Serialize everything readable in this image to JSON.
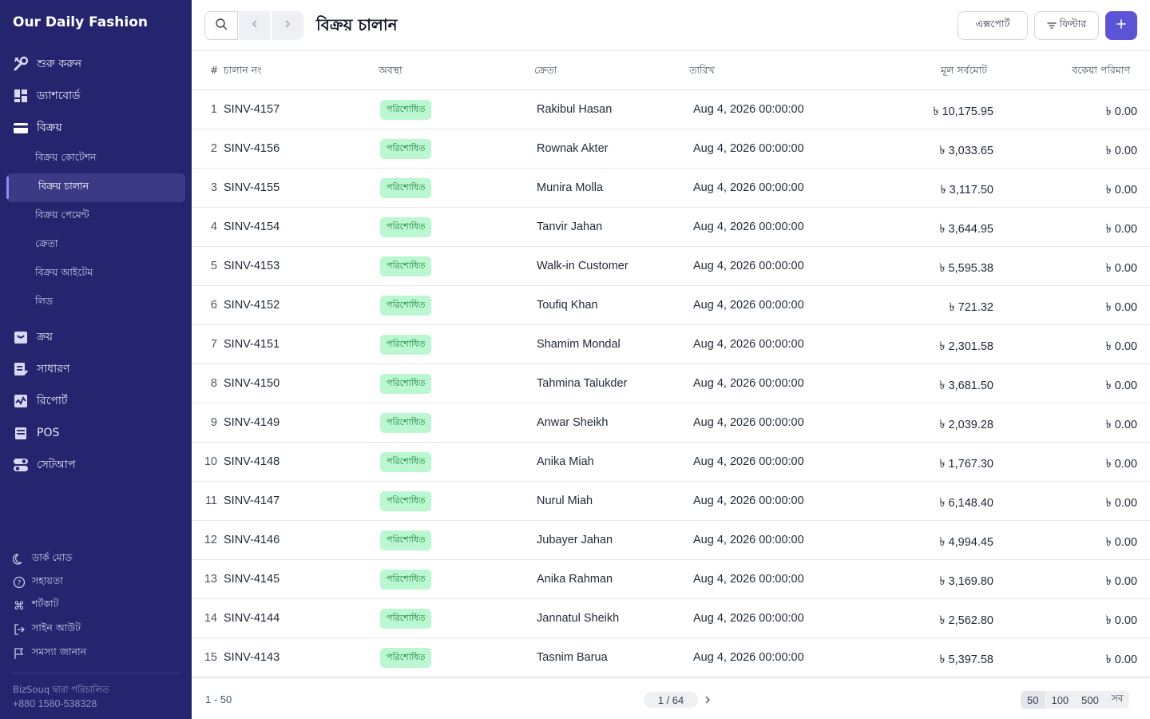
{
  "app": {
    "brand": "Our Daily Fashion",
    "powered_by": "BizSouq দ্বারা পরিচালিত",
    "phone": "+880 1580-538328"
  },
  "colors": {
    "sidebar_bg": "#25246e",
    "accent": "#5b55d6",
    "status_bg": "#bbf7d0",
    "status_text": "#15803d"
  },
  "sidebar": {
    "main": [
      {
        "label": "শুরু করুন",
        "icon": "tools-icon"
      },
      {
        "label": "ড্যাশবোর্ড",
        "icon": "dashboard-icon"
      },
      {
        "label": "বিক্রয়",
        "icon": "sales-card-icon"
      }
    ],
    "sub": [
      {
        "label": "বিক্রয় কোটেশন"
      },
      {
        "label": "বিক্রয় চালান",
        "active": true
      },
      {
        "label": "বিক্রয় পেমেন্ট"
      },
      {
        "label": "ক্রেতা"
      },
      {
        "label": "বিক্রয় আইটেম"
      },
      {
        "label": "লিড"
      }
    ],
    "more": [
      {
        "label": "ক্রয়",
        "icon": "purchase-icon"
      },
      {
        "label": "সাধারণ",
        "icon": "general-icon"
      },
      {
        "label": "রিপোর্ট",
        "icon": "report-icon"
      },
      {
        "label": "POS",
        "icon": "pos-icon"
      },
      {
        "label": "সেটআপ",
        "icon": "setup-icon"
      }
    ],
    "footer": [
      {
        "label": "ডার্ক মোড",
        "icon": "moon-icon"
      },
      {
        "label": "সহায়তা",
        "icon": "help-icon"
      },
      {
        "label": "শর্টকাট",
        "icon": "command-icon"
      },
      {
        "label": "সাইন আউট",
        "icon": "sign-out-icon"
      },
      {
        "label": "সমস্যা জানান",
        "icon": "flag-icon"
      }
    ]
  },
  "header": {
    "title": "বিক্রয় চালান",
    "export_label": "এক্সপোর্ট",
    "filter_label": "ফিল্টার"
  },
  "table": {
    "columns": {
      "num": "#",
      "invoice": "চালান নং",
      "status": "অবস্থা",
      "customer": "ক্রেতা",
      "date": "তারিখ",
      "grand_total": "মূল সর্বমোট",
      "outstanding": "বকেয়া পরিমাণ"
    },
    "rows": [
      {
        "num": "1",
        "invoice": "SINV-4157",
        "status": "পরিশোধিত",
        "customer": "Rakibul Hasan",
        "date": "Aug 4, 2026 00:00:00",
        "grand_total": "৳ 10,175.95",
        "outstanding": "৳ 0.00"
      },
      {
        "num": "2",
        "invoice": "SINV-4156",
        "status": "পরিশোধিত",
        "customer": "Rownak Akter",
        "date": "Aug 4, 2026 00:00:00",
        "grand_total": "৳ 3,033.65",
        "outstanding": "৳ 0.00"
      },
      {
        "num": "3",
        "invoice": "SINV-4155",
        "status": "পরিশোধিত",
        "customer": "Munira Molla",
        "date": "Aug 4, 2026 00:00:00",
        "grand_total": "৳ 3,117.50",
        "outstanding": "৳ 0.00"
      },
      {
        "num": "4",
        "invoice": "SINV-4154",
        "status": "পরিশোধিত",
        "customer": "Tanvir Jahan",
        "date": "Aug 4, 2026 00:00:00",
        "grand_total": "৳ 3,644.95",
        "outstanding": "৳ 0.00"
      },
      {
        "num": "5",
        "invoice": "SINV-4153",
        "status": "পরিশোধিত",
        "customer": "Walk-in Customer",
        "date": "Aug 4, 2026 00:00:00",
        "grand_total": "৳ 5,595.38",
        "outstanding": "৳ 0.00"
      },
      {
        "num": "6",
        "invoice": "SINV-4152",
        "status": "পরিশোধিত",
        "customer": "Toufiq Khan",
        "date": "Aug 4, 2026 00:00:00",
        "grand_total": "৳ 721.32",
        "outstanding": "৳ 0.00"
      },
      {
        "num": "7",
        "invoice": "SINV-4151",
        "status": "পরিশোধিত",
        "customer": "Shamim Mondal",
        "date": "Aug 4, 2026 00:00:00",
        "grand_total": "৳ 2,301.58",
        "outstanding": "৳ 0.00"
      },
      {
        "num": "8",
        "invoice": "SINV-4150",
        "status": "পরিশোধিত",
        "customer": "Tahmina Talukder",
        "date": "Aug 4, 2026 00:00:00",
        "grand_total": "৳ 3,681.50",
        "outstanding": "৳ 0.00"
      },
      {
        "num": "9",
        "invoice": "SINV-4149",
        "status": "পরিশোধিত",
        "customer": "Anwar Sheikh",
        "date": "Aug 4, 2026 00:00:00",
        "grand_total": "৳ 2,039.28",
        "outstanding": "৳ 0.00"
      },
      {
        "num": "10",
        "invoice": "SINV-4148",
        "status": "পরিশোধিত",
        "customer": "Anika Miah",
        "date": "Aug 4, 2026 00:00:00",
        "grand_total": "৳ 1,767.30",
        "outstanding": "৳ 0.00"
      },
      {
        "num": "11",
        "invoice": "SINV-4147",
        "status": "পরিশোধিত",
        "customer": "Nurul Miah",
        "date": "Aug 4, 2026 00:00:00",
        "grand_total": "৳ 6,148.40",
        "outstanding": "৳ 0.00"
      },
      {
        "num": "12",
        "invoice": "SINV-4146",
        "status": "পরিশোধিত",
        "customer": "Jubayer Jahan",
        "date": "Aug 4, 2026 00:00:00",
        "grand_total": "৳ 4,994.45",
        "outstanding": "৳ 0.00"
      },
      {
        "num": "13",
        "invoice": "SINV-4145",
        "status": "পরিশোধিত",
        "customer": "Anika Rahman",
        "date": "Aug 4, 2026 00:00:00",
        "grand_total": "৳ 3,169.80",
        "outstanding": "৳ 0.00"
      },
      {
        "num": "14",
        "invoice": "SINV-4144",
        "status": "পরিশোধিত",
        "customer": "Jannatul Sheikh",
        "date": "Aug 4, 2026 00:00:00",
        "grand_total": "৳ 2,562.80",
        "outstanding": "৳ 0.00"
      },
      {
        "num": "15",
        "invoice": "SINV-4143",
        "status": "পরিশোধিত",
        "customer": "Tasnim Barua",
        "date": "Aug 4, 2026 00:00:00",
        "grand_total": "৳ 5,397.58",
        "outstanding": "৳ 0.00"
      }
    ]
  },
  "pagination": {
    "range": "1 - 50",
    "page": "1 / 64",
    "sizes": [
      "50",
      "100",
      "500",
      "সব"
    ]
  }
}
